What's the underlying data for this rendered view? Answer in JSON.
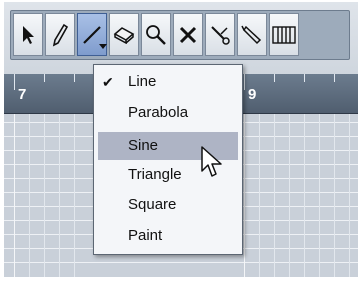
{
  "toolbar": {
    "tools": [
      {
        "name": "object-selection-tool",
        "icon": "arrow-pointer-icon"
      },
      {
        "name": "draw-tool",
        "icon": "pencil-icon"
      },
      {
        "name": "line-tool",
        "icon": "line-icon",
        "active": true
      },
      {
        "name": "eraser-tool",
        "icon": "eraser-icon"
      },
      {
        "name": "zoom-tool",
        "icon": "magnifier-icon"
      },
      {
        "name": "delete-tool",
        "icon": "x-icon"
      },
      {
        "name": "split-tool",
        "icon": "scissors-icon"
      },
      {
        "name": "glue-tool",
        "icon": "glue-tube-icon"
      },
      {
        "name": "drumstick-tool",
        "icon": "drumstick-bars-icon"
      }
    ]
  },
  "ruler": {
    "labels": [
      "7",
      "9"
    ]
  },
  "menu": {
    "items": [
      "Line",
      "Parabola",
      "Sine",
      "Triangle",
      "Square",
      "Paint"
    ],
    "checked_index": 0,
    "highlighted_index": 2,
    "check_glyph": "✔"
  },
  "colors": {
    "menu_highlight": "#aeb4c5",
    "active_tool": "#7f9ccd"
  }
}
